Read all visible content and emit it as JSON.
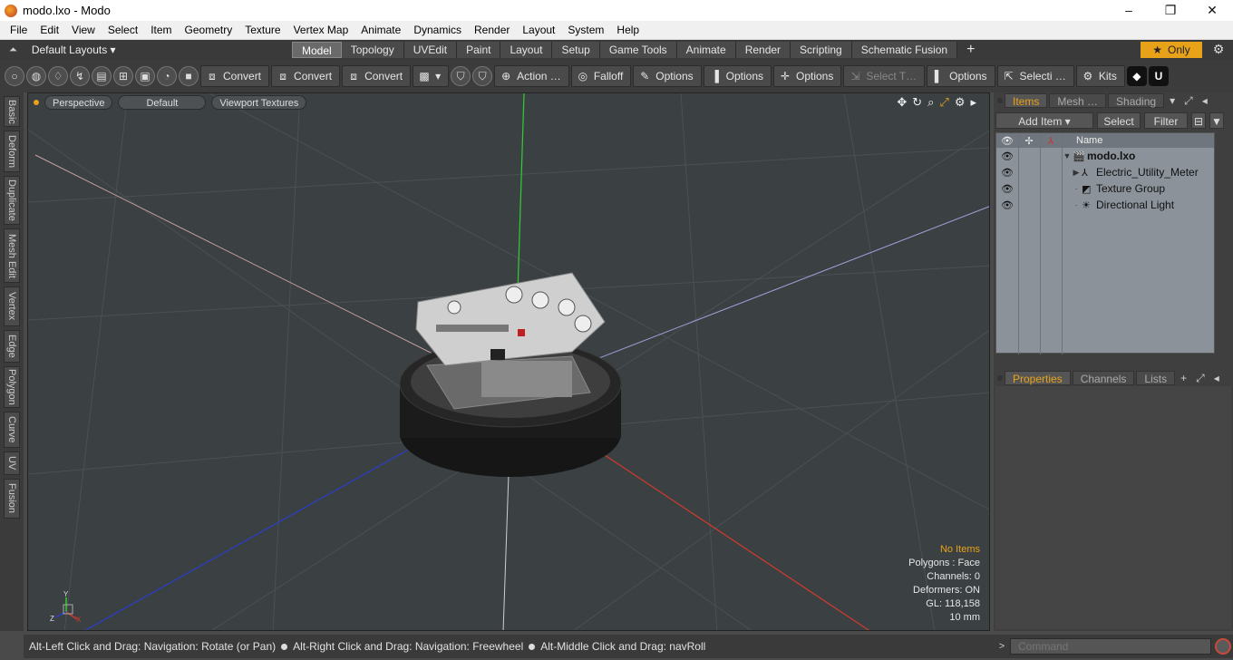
{
  "window": {
    "title": "modo.lxo - Modo",
    "minimize": "–",
    "maximize": "❐",
    "close": "✕"
  },
  "menu": [
    "File",
    "Edit",
    "View",
    "Select",
    "Item",
    "Geometry",
    "Texture",
    "Vertex Map",
    "Animate",
    "Dynamics",
    "Render",
    "Layout",
    "System",
    "Help"
  ],
  "layoutbar": {
    "layouts_label": "Default Layouts ▾",
    "tabs": [
      "Model",
      "Topology",
      "UVEdit",
      "Paint",
      "Layout",
      "Setup",
      "Game Tools",
      "Animate",
      "Render",
      "Scripting",
      "Schematic Fusion"
    ],
    "active_tab": "Model",
    "plus": "+",
    "only_label": "Only"
  },
  "toolbar": {
    "convert1": "Convert",
    "convert2": "Convert",
    "convert3": "Convert",
    "action": "Action …",
    "falloff": "Falloff",
    "options1": "Options",
    "options2": "Options",
    "options3": "Options",
    "select_t": "Select T…",
    "options4": "Options",
    "selecti": "Selecti …",
    "kits": "Kits"
  },
  "left_tabs": [
    "Basic",
    "Deform",
    "Duplicate",
    "Mesh Edit",
    "Vertex",
    "Edge",
    "Polygon",
    "Curve",
    "UV",
    "Fusion"
  ],
  "viewport": {
    "view_mode": "Perspective",
    "shading": "Default",
    "textures": "Viewport Textures",
    "info": {
      "no_items": "No Items",
      "polygons": "Polygons : Face",
      "channels": "Channels: 0",
      "deformers": "Deformers: ON",
      "gl": "GL: 118,158",
      "scale": "10 mm"
    },
    "gizmo": {
      "y": "Y",
      "z": "Z",
      "x": "X"
    }
  },
  "status": {
    "hint1": "Alt-Left Click and Drag: Navigation: Rotate (or Pan)",
    "hint2": "Alt-Right Click and Drag: Navigation: Freewheel",
    "hint3": "Alt-Middle Click and Drag: navRoll"
  },
  "items_panel": {
    "tabs": [
      "Items",
      "Mesh …",
      "Shading"
    ],
    "add_item": "Add Item",
    "select": "Select",
    "filter": "Filter",
    "column_name": "Name",
    "rows": [
      {
        "name": "modo.lxo",
        "bold": true
      },
      {
        "name": "Electric_Utility_Meter"
      },
      {
        "name": "Texture Group"
      },
      {
        "name": "Directional Light"
      }
    ]
  },
  "props_panel": {
    "tabs": [
      "Properties",
      "Channels",
      "Lists"
    ],
    "plus": "+"
  },
  "command": {
    "placeholder": "Command",
    "prompt": ">"
  },
  "colors": {
    "accent": "#e8a21a",
    "viewport_bg": "#3b4043",
    "x_axis": "#d33a2c",
    "y_axis": "#33cc33",
    "z_axis": "#2a3fc8"
  }
}
